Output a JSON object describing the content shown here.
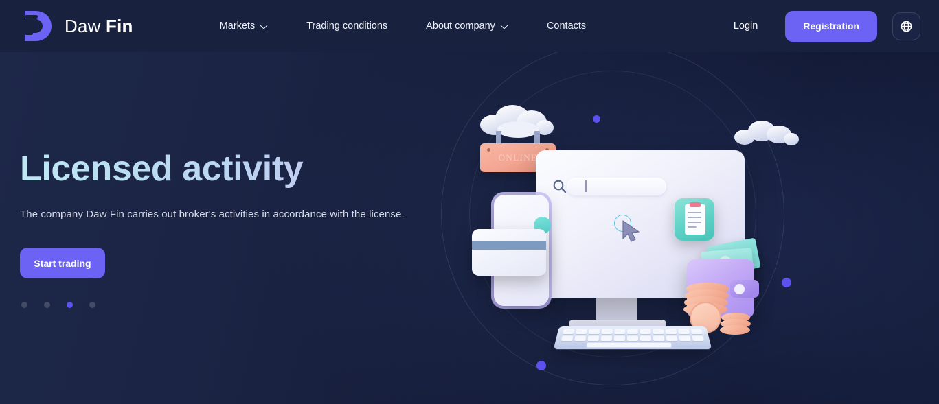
{
  "header": {
    "logo_icon": "dawfin-d-logo",
    "brand_light": "Daw ",
    "brand_bold": "Fin",
    "nav": [
      {
        "label": "Markets",
        "has_chevron": true,
        "icon": "chevron-down-icon"
      },
      {
        "label": "Trading conditions",
        "has_chevron": false
      },
      {
        "label": "About company",
        "has_chevron": true,
        "icon": "chevron-down-icon"
      },
      {
        "label": "Contacts",
        "has_chevron": false
      }
    ],
    "login_label": "Login",
    "registration_label": "Registration",
    "language_icon": "globe-icon",
    "background": "#18213d",
    "accent": "#6c63f5"
  },
  "hero": {
    "title": "Licensed activity",
    "subtitle": "The company Daw Fin carries out broker's activities in accordance with the license.",
    "cta_label": "Start trading",
    "title_gradient_from": "#bfe9f5",
    "title_gradient_to": "#cbb9ee",
    "carousel": {
      "total": 4,
      "active_index": 2,
      "dot_color": "#434c66",
      "active_dot_color": "#5b52f0"
    }
  },
  "illustration": {
    "name": "online-trading-3d-illustration",
    "sign_label": "ONLINE",
    "elements": [
      "cloud-large",
      "cloud-small",
      "online-sign",
      "desktop-monitor",
      "search-bar",
      "mouse-cursor",
      "clipboard-tile",
      "smartphone",
      "credit-card",
      "wallet",
      "coin-stack",
      "banknotes",
      "keyboard",
      "orbit-ring-outer",
      "orbit-ring-inner"
    ],
    "accent_dots": "#5b52f0"
  }
}
